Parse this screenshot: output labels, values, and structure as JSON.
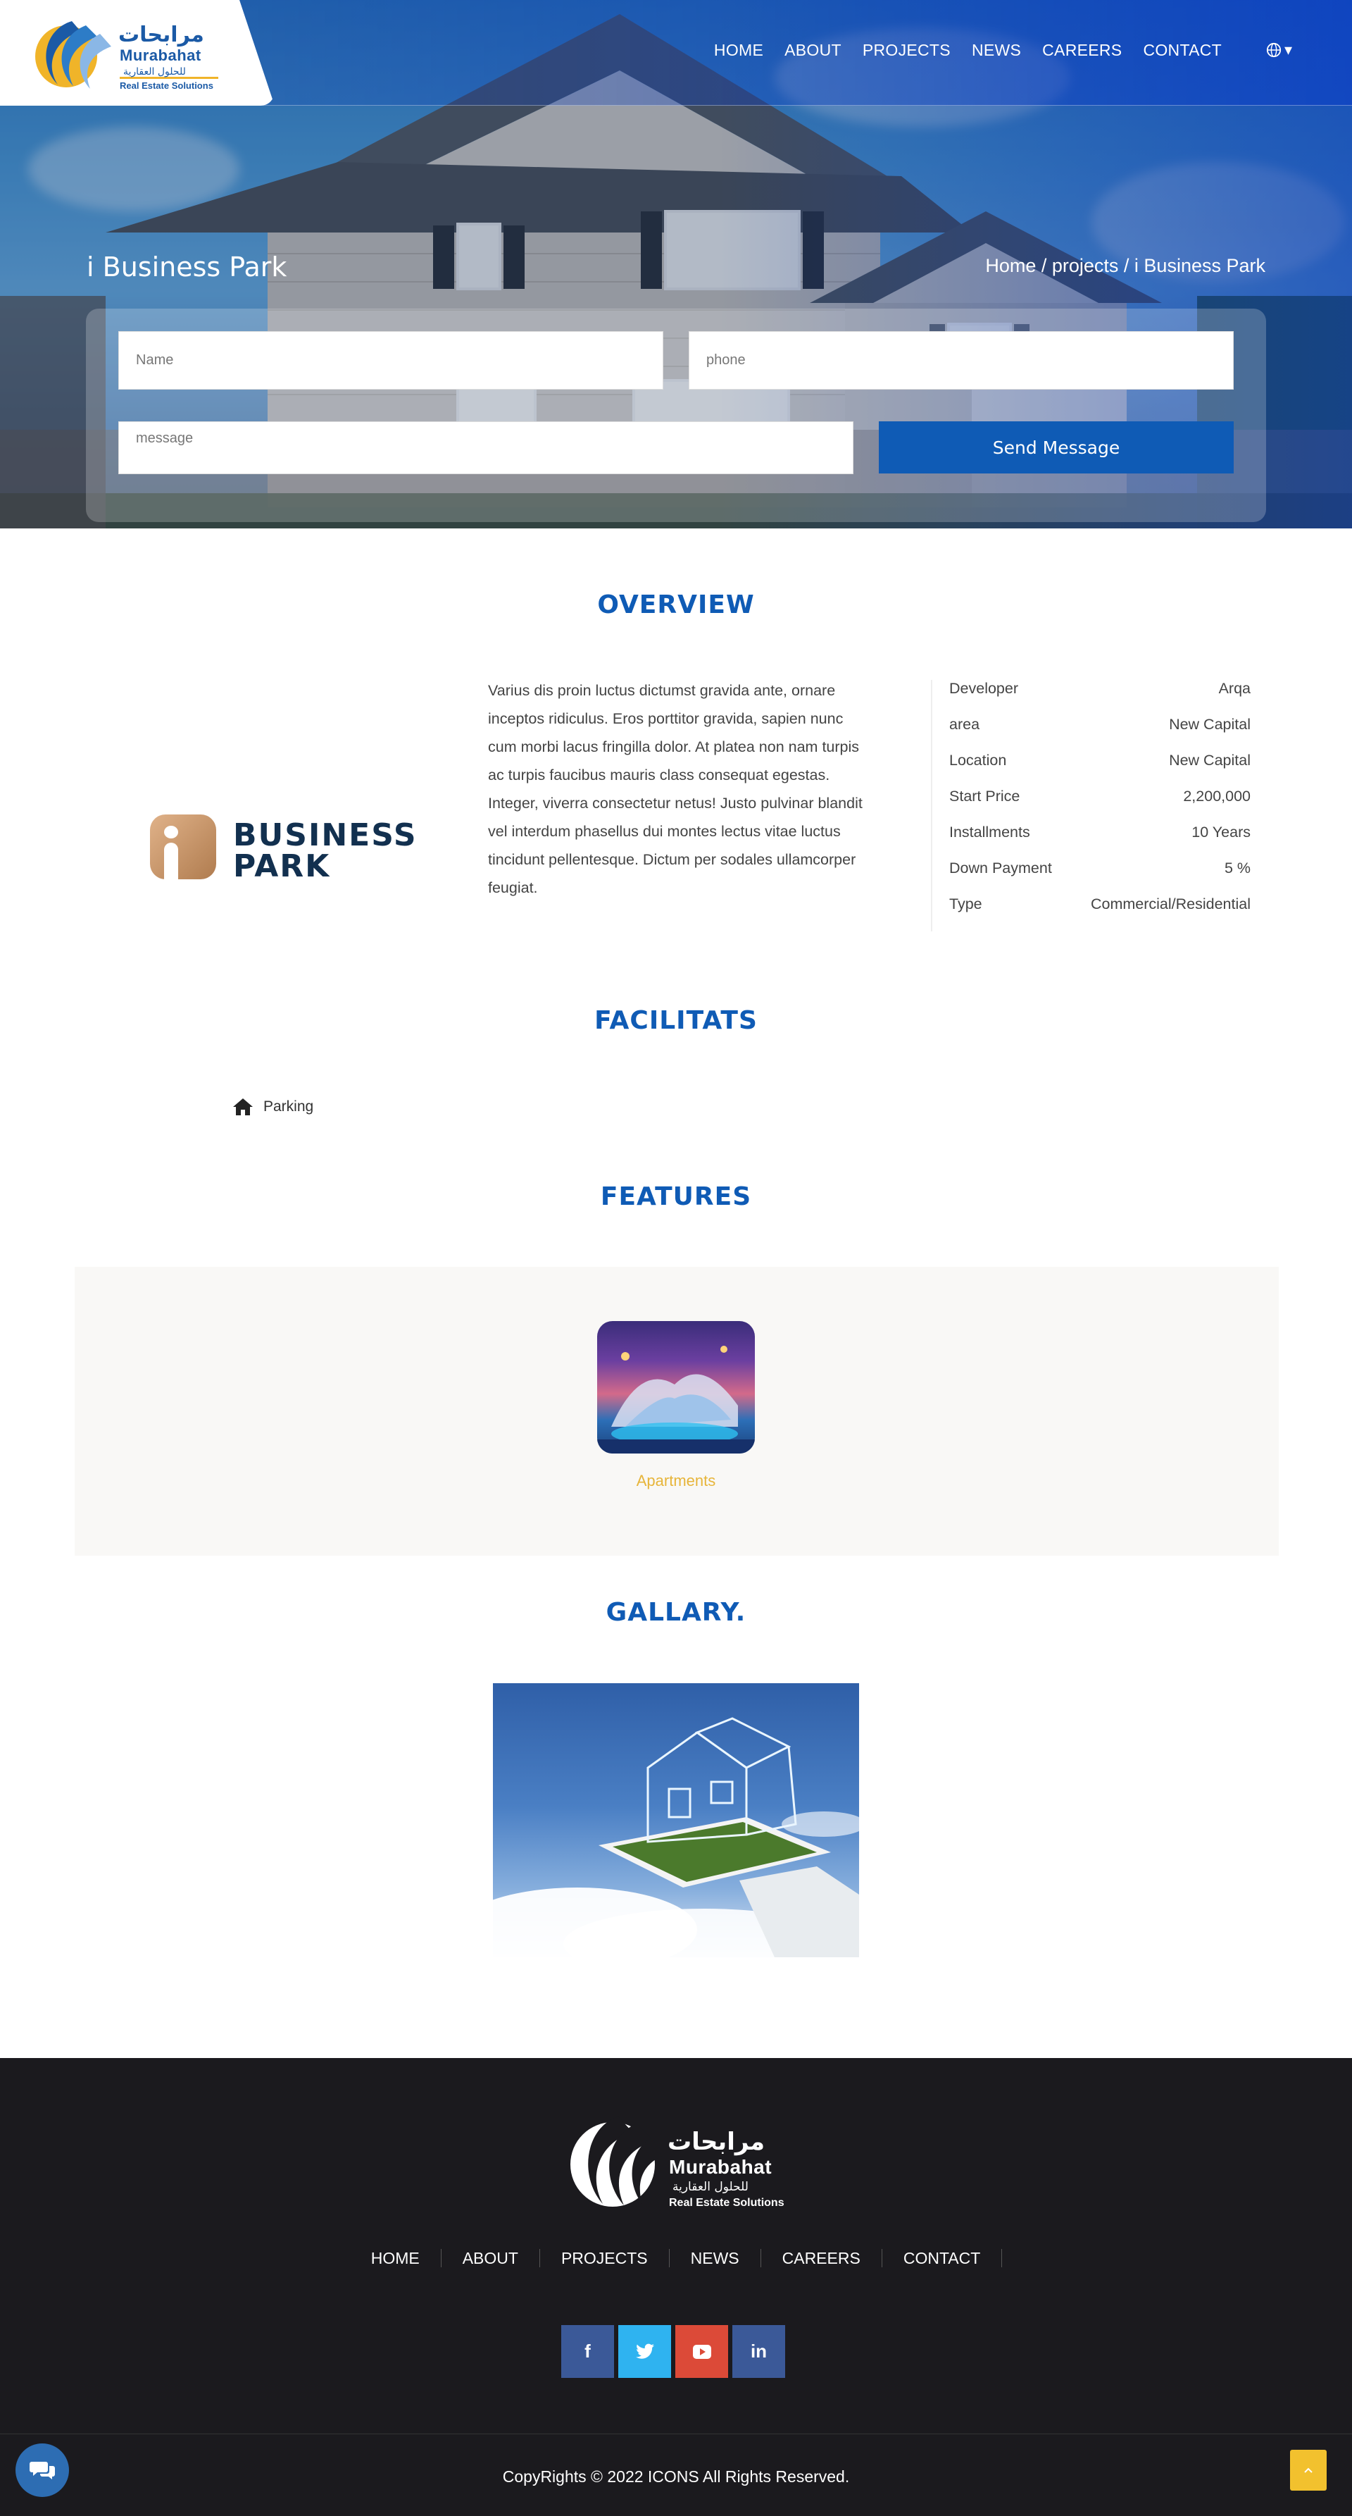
{
  "header": {
    "logo": {
      "ar": "مرابحات",
      "en": "Murabahat",
      "ar_sub": "للحلول العقارية",
      "en_sub": "Real Estate Solutions"
    },
    "nav": [
      "HOME",
      "ABOUT",
      "PROJECTS",
      "NEWS",
      "CAREERS",
      "CONTACT"
    ],
    "lang_icon": "globe-icon",
    "lang_caret": "▾"
  },
  "hero": {
    "title": "i Business Park",
    "breadcrumb": "Home / projects / i Business Park"
  },
  "form": {
    "name_placeholder": "Name",
    "phone_placeholder": "phone",
    "message_placeholder": "message",
    "send_label": "Send Message"
  },
  "overview": {
    "title": "OVERVIEW",
    "logo_line1": "BUSINESS",
    "logo_line2": "PARK",
    "description": "Varius dis proin luctus dictumst gravida ante, ornare inceptos ridiculus. Eros porttitor gravida, sapien nunc cum morbi lacus fringilla dolor. At platea non nam turpis ac turpis faucibus mauris class consequat egestas. Integer, viverra consectetur netus! Justo pulvinar blandit vel interdum phasellus dui montes lectus vitae luctus tincidunt pellentesque. Dictum per sodales ullamcorper feugiat.",
    "specs": [
      {
        "label": "Developer",
        "value": "Arqa"
      },
      {
        "label": "area",
        "value": "New Capital"
      },
      {
        "label": "Location",
        "value": "New Capital"
      },
      {
        "label": "Start Price",
        "value": "2,200,000"
      },
      {
        "label": "Installments",
        "value": "10 Years"
      },
      {
        "label": "Down Payment",
        "value": "5 %"
      },
      {
        "label": "Type",
        "value": "Commercial/Residential"
      }
    ]
  },
  "facilities": {
    "title": "FACILITATS",
    "items": [
      {
        "icon": "home-icon",
        "label": "Parking"
      }
    ]
  },
  "features": {
    "title": "FEATURES",
    "items": [
      {
        "label": "Apartments"
      }
    ]
  },
  "gallery": {
    "title": "GALLARY."
  },
  "footer": {
    "logo": {
      "ar": "مرابحات",
      "en": "Murabahat",
      "ar_sub": "للحلول العقارية",
      "en_sub": "Real Estate Solutions"
    },
    "nav": [
      "HOME",
      "ABOUT",
      "PROJECTS",
      "NEWS",
      "CAREERS",
      "CONTACT"
    ],
    "socials": [
      {
        "icon": "facebook-icon",
        "glyph": "f"
      },
      {
        "icon": "twitter-icon",
        "glyph": "t"
      },
      {
        "icon": "youtube-icon",
        "glyph": "▶"
      },
      {
        "icon": "linkedin-icon",
        "glyph": "in"
      }
    ],
    "copyright": "CopyRights © 2022 ICONS All Rights Reserved."
  },
  "colors": {
    "primary": "#0f5bb5",
    "accent": "#e7b53a",
    "footer_bg": "#1b1a1e"
  }
}
